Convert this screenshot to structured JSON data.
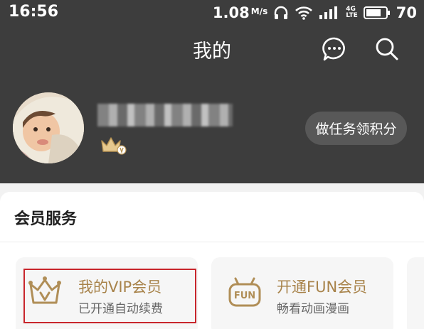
{
  "status_bar": {
    "time": "16:56",
    "net_speed": "1.08",
    "net_speed_unit": "M/s",
    "network_type_top": "4G",
    "network_type_bottom": "LTE",
    "battery_level": "70"
  },
  "top_bar": {
    "title": "我的",
    "message_icon": "chat-bubble-icon",
    "search_icon": "search-icon"
  },
  "profile": {
    "avatar": "child-photo-avatar",
    "username": "",
    "badge_icon": "crown-badge-icon",
    "task_button_label": "做任务领积分"
  },
  "member_services": {
    "section_title": "会员服务",
    "cards": [
      {
        "icon": "crown-v-icon",
        "title": "我的VIP会员",
        "subtitle": "已开通自动续费"
      },
      {
        "icon": "fun-badge-icon",
        "title": "开通FUN会员",
        "subtitle": "畅看动画漫画"
      }
    ]
  },
  "colors": {
    "header_bg": "#3d3d3d",
    "accent_gold": "#a8834a",
    "highlight_red": "#c8262c"
  }
}
